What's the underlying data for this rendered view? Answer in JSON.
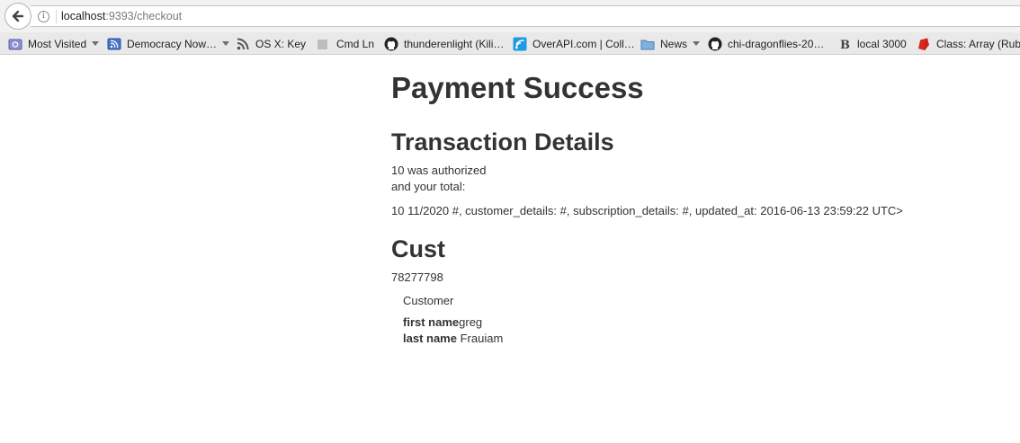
{
  "browser": {
    "url_host": "localhost",
    "url_rest": ":9393/checkout",
    "bookmarks": [
      {
        "label": "Most Visited",
        "icon": "gear-folder-icon",
        "has_menu": true
      },
      {
        "label": "Democracy Now…",
        "icon": "rss-feed-icon",
        "has_menu": true
      },
      {
        "label": "OS X: Key",
        "icon": "rss-icon",
        "has_menu": false
      },
      {
        "label": "Cmd Ln",
        "icon": "blank-page-icon",
        "has_menu": false
      },
      {
        "label": "thunderenlight (Kili…",
        "icon": "github-icon",
        "has_menu": false
      },
      {
        "label": "OverAPI.com | Coll…",
        "icon": "overapi-icon",
        "has_menu": false
      },
      {
        "label": "News",
        "icon": "folder-icon",
        "has_menu": true
      },
      {
        "label": "chi-dragonflies-20…",
        "icon": "github-icon",
        "has_menu": false
      },
      {
        "label": "local 3000",
        "icon": "bootstrap-b-icon",
        "has_menu": false
      },
      {
        "label": "Class: Array (Ruby",
        "icon": "ruby-icon",
        "has_menu": false
      }
    ]
  },
  "page": {
    "title": "Payment Success",
    "transaction_heading": "Transaction Details",
    "authorized_line": "10 was authorized",
    "total_line": "and your total:",
    "details_line": "10 11/2020 #, customer_details: #, subscription_details: #, updated_at: 2016-06-13 23:59:22 UTC>",
    "cust_heading": "Cust",
    "cust_id": "78277798",
    "customer": {
      "heading": "Customer",
      "first_name_label": "first name",
      "first_name_value": "greg",
      "last_name_label": "last name",
      "last_name_value": "Frauiam"
    }
  }
}
